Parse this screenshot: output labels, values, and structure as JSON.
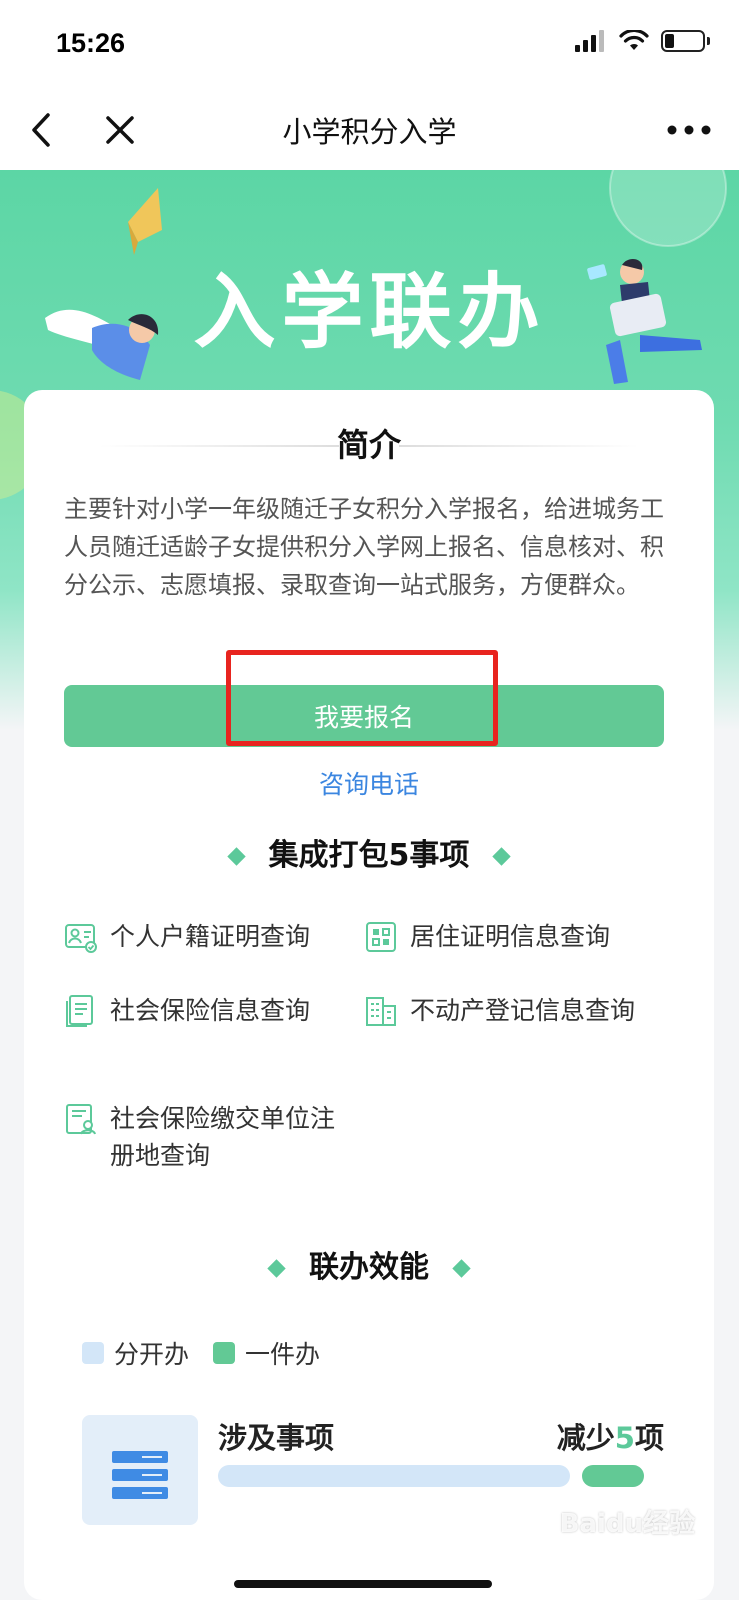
{
  "status_bar": {
    "time": "15:26",
    "battery_level": 0.25
  },
  "nav": {
    "title": "小学积分入学"
  },
  "banner": {
    "title": "入学联办",
    "accent_color": "#5cd6a5"
  },
  "intro": {
    "heading": "简介",
    "text": "主要针对小学一年级随迁子女积分入学报名，给进城务工人员随迁适龄子女提供积分入学网上报名、信息核对、积分公示、志愿填报、录取查询一站式服务，方便群众。"
  },
  "actions": {
    "apply_label": "我要报名",
    "consult_label": "咨询电话",
    "apply_color": "#62c995",
    "highlight_color": "#e8241f"
  },
  "services": {
    "heading": "集成打包5事项",
    "items": [
      {
        "label": "个人户籍证明查询",
        "icon": "id-card-icon"
      },
      {
        "label": "居住证明信息查询",
        "icon": "residence-icon"
      },
      {
        "label": "社会保险信息查询",
        "icon": "document-icon"
      },
      {
        "label": "不动产登记信息查询",
        "icon": "building-icon"
      },
      {
        "label": "社会保险缴交单位注册地查询",
        "icon": "insurance-icon"
      }
    ]
  },
  "efficiency": {
    "heading": "联办效能",
    "legend": [
      {
        "label": "分开办",
        "color": "#d3e6f8"
      },
      {
        "label": "一件办",
        "color": "#62c995"
      }
    ],
    "rows": [
      {
        "label": "涉及事项",
        "value_prefix": "减少",
        "value_num": "5",
        "value_suffix": "项",
        "separate": 5,
        "combined": 1
      }
    ]
  },
  "watermark": "Baidu经验"
}
